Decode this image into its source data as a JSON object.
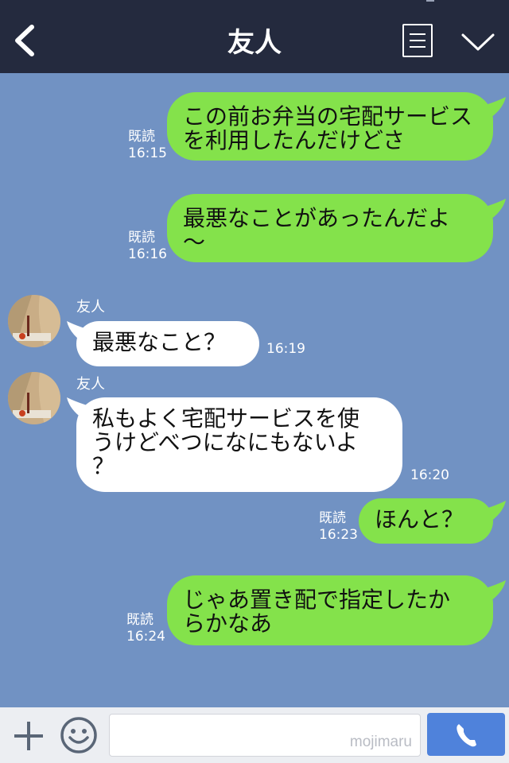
{
  "header": {
    "title": "友人"
  },
  "messages": [
    {
      "side": "me",
      "text": "この前お弁当の宅配サービス\nを利用したんだけどさ",
      "read": "既読",
      "time": "16:15"
    },
    {
      "side": "me",
      "text": "最悪なことがあったんだよ\n〜",
      "read": "既読",
      "time": "16:16"
    },
    {
      "side": "friend",
      "sender": "友人",
      "text": "最悪なこと？",
      "time": "16:19"
    },
    {
      "side": "friend",
      "sender": "友人",
      "text": "私もよく宅配サービスを使\nうけどべつになにもないよ\n？",
      "time": "16:20"
    },
    {
      "side": "me",
      "text": "ほんと？",
      "read": "既読",
      "time": "16:23"
    },
    {
      "side": "me",
      "text": "じゃあ置き配で指定したか\nらかなあ",
      "read": "既読",
      "time": "16:24"
    }
  ],
  "footer": {
    "watermark": "mojimaru"
  },
  "colors": {
    "header": "#242a3e",
    "background": "#7192c3",
    "my_bubble": "#84e24b",
    "friend_bubble": "#ffffff",
    "call_button": "#4f82db"
  },
  "icons": {
    "back": "chevron-left-icon",
    "menu": "list-icon",
    "collapse": "chevron-down-icon",
    "add": "plus-icon",
    "emoji": "smiley-icon",
    "call": "phone-icon"
  }
}
